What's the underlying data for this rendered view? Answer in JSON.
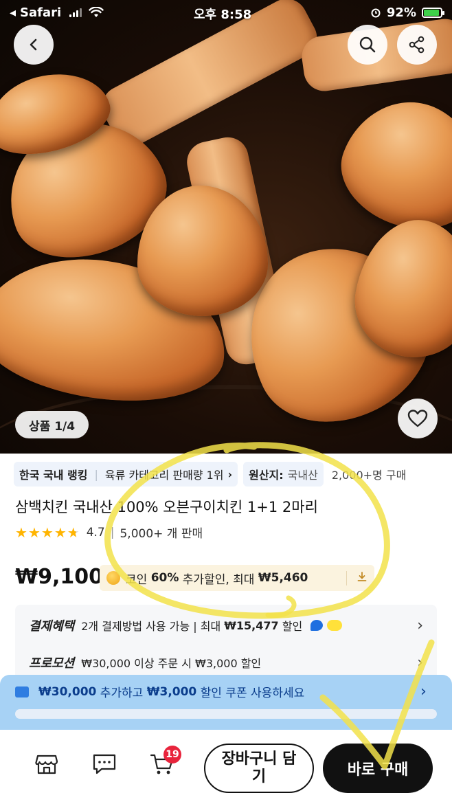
{
  "status_bar": {
    "back_app": "Safari",
    "time": "오후 8:58",
    "battery": "92%"
  },
  "gallery": {
    "page_indicator": "상품 1/4",
    "current_index": 1,
    "total_images": 4
  },
  "chips": {
    "ranking_label": "한국 국내 랭킹",
    "ranking_value": "육류 카테고리 판매량 1위",
    "origin_label": "원산지:",
    "origin_value": "국내산",
    "buyers": "2,000+명 구매"
  },
  "product": {
    "title": "삼백치킨 국내산 100% 오븐구이치킨 1+1 2마리",
    "rating": "4.7",
    "rating_value": 4.7,
    "sold": "5,000+ 개 판매",
    "price": "₩9,100"
  },
  "coin_offer": {
    "prefix": "코인 ",
    "percent": "60%",
    "middle": " 추가할인, 최대 ",
    "max": "₩5,460"
  },
  "benefits": {
    "payment_label": "결제혜택",
    "payment_prefix": "2개 결제방법 사용 가능 | 최대 ",
    "payment_amount": "₩15,477",
    "payment_suffix": " 할인",
    "promo_label": "프로모션",
    "promo_text": "₩30,000 이상 주문 시 ₩3,000 할인"
  },
  "coupon": {
    "amount": "₩30,000",
    "middle": " 추가하고 ",
    "discount": "₩3,000",
    "suffix": " 할인 쿠폰 사용하세요",
    "progress": 0.0
  },
  "bottom": {
    "cart_count": "19",
    "cart_button": "장바구니 담기",
    "buy_button": "바로 구매"
  },
  "colors": {
    "accent_blue": "#2f7de1",
    "star": "#ffb400",
    "badge_red": "#e8243c",
    "annotation": "#f2e24a"
  },
  "icons": [
    "back-arrow-icon",
    "search-icon",
    "share-icon",
    "heart-icon",
    "store-icon",
    "chat-icon",
    "cart-icon",
    "download-icon",
    "ticket-icon"
  ]
}
